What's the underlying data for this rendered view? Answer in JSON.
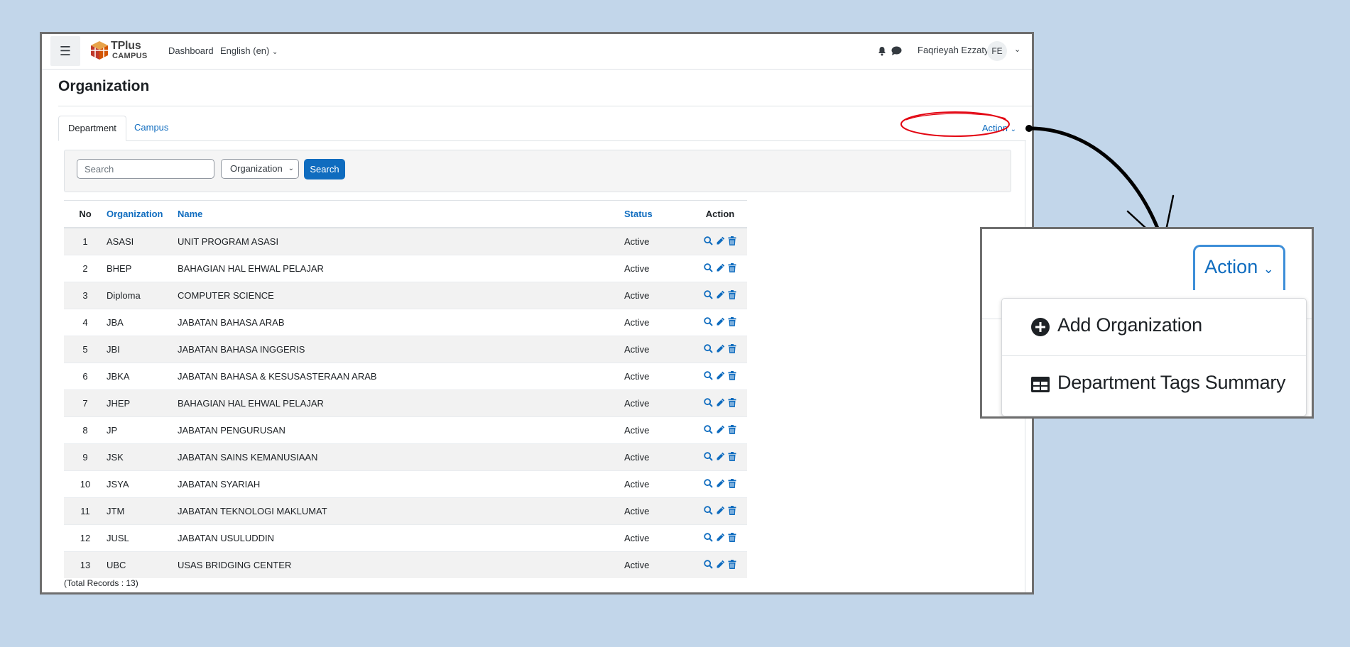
{
  "navbar": {
    "menu_icon": "hamburger-icon",
    "logo_line1": "TPlus",
    "logo_line2": "CAMPUS",
    "dashboard": "Dashboard",
    "language": "English (en)",
    "user_name": "Faqrieyah Ezzaty",
    "user_initials": "FE"
  },
  "page": {
    "title": "Organization",
    "tabs": [
      {
        "label": "Department",
        "active": true
      },
      {
        "label": "Campus",
        "active": false
      }
    ],
    "action_label": "Action"
  },
  "search": {
    "placeholder": "Search",
    "filter_selected": "Organization",
    "button_label": "Search"
  },
  "table": {
    "headers": {
      "no": "No",
      "organization": "Organization",
      "name": "Name",
      "status": "Status",
      "action": "Action"
    },
    "rows": [
      {
        "no": "1",
        "org": "ASASI",
        "name": "UNIT PROGRAM ASASI",
        "status": "Active"
      },
      {
        "no": "2",
        "org": "BHEP",
        "name": "BAHAGIAN HAL EHWAL PELAJAR",
        "status": "Active"
      },
      {
        "no": "3",
        "org": "Diploma",
        "name": "COMPUTER SCIENCE",
        "status": "Active"
      },
      {
        "no": "4",
        "org": "JBA",
        "name": "JABATAN BAHASA ARAB",
        "status": "Active"
      },
      {
        "no": "5",
        "org": "JBI",
        "name": "JABATAN BAHASA INGGERIS",
        "status": "Active"
      },
      {
        "no": "6",
        "org": "JBKA",
        "name": "JABATAN BAHASA & KESUSASTERAAN ARAB",
        "status": "Active"
      },
      {
        "no": "7",
        "org": "JHEP",
        "name": "BAHAGIAN HAL EHWAL PELAJAR",
        "status": "Active"
      },
      {
        "no": "8",
        "org": "JP",
        "name": "JABATAN PENGURUSAN",
        "status": "Active"
      },
      {
        "no": "9",
        "org": "JSK",
        "name": "JABATAN SAINS KEMANUSIAAN",
        "status": "Active"
      },
      {
        "no": "10",
        "org": "JSYA",
        "name": "JABATAN SYARIAH",
        "status": "Active"
      },
      {
        "no": "11",
        "org": "JTM",
        "name": "JABATAN TEKNOLOGI MAKLUMAT",
        "status": "Active"
      },
      {
        "no": "12",
        "org": "JUSL",
        "name": "JABATAN USULUDDIN",
        "status": "Active"
      },
      {
        "no": "13",
        "org": "UBC",
        "name": "USAS BRIDGING CENTER",
        "status": "Active"
      }
    ],
    "total": "(Total Records : 13)"
  },
  "zoom": {
    "action_label": "Action",
    "menu_items": [
      {
        "label": "Add Organization",
        "icon": "plus-circle-icon"
      },
      {
        "label": "Department Tags Summary",
        "icon": "table-icon"
      }
    ]
  },
  "colors": {
    "background": "#c2d6ea",
    "link": "#0f6cbf",
    "primary_button": "#0f6cbf",
    "highlight_ellipse": "#e30613"
  }
}
